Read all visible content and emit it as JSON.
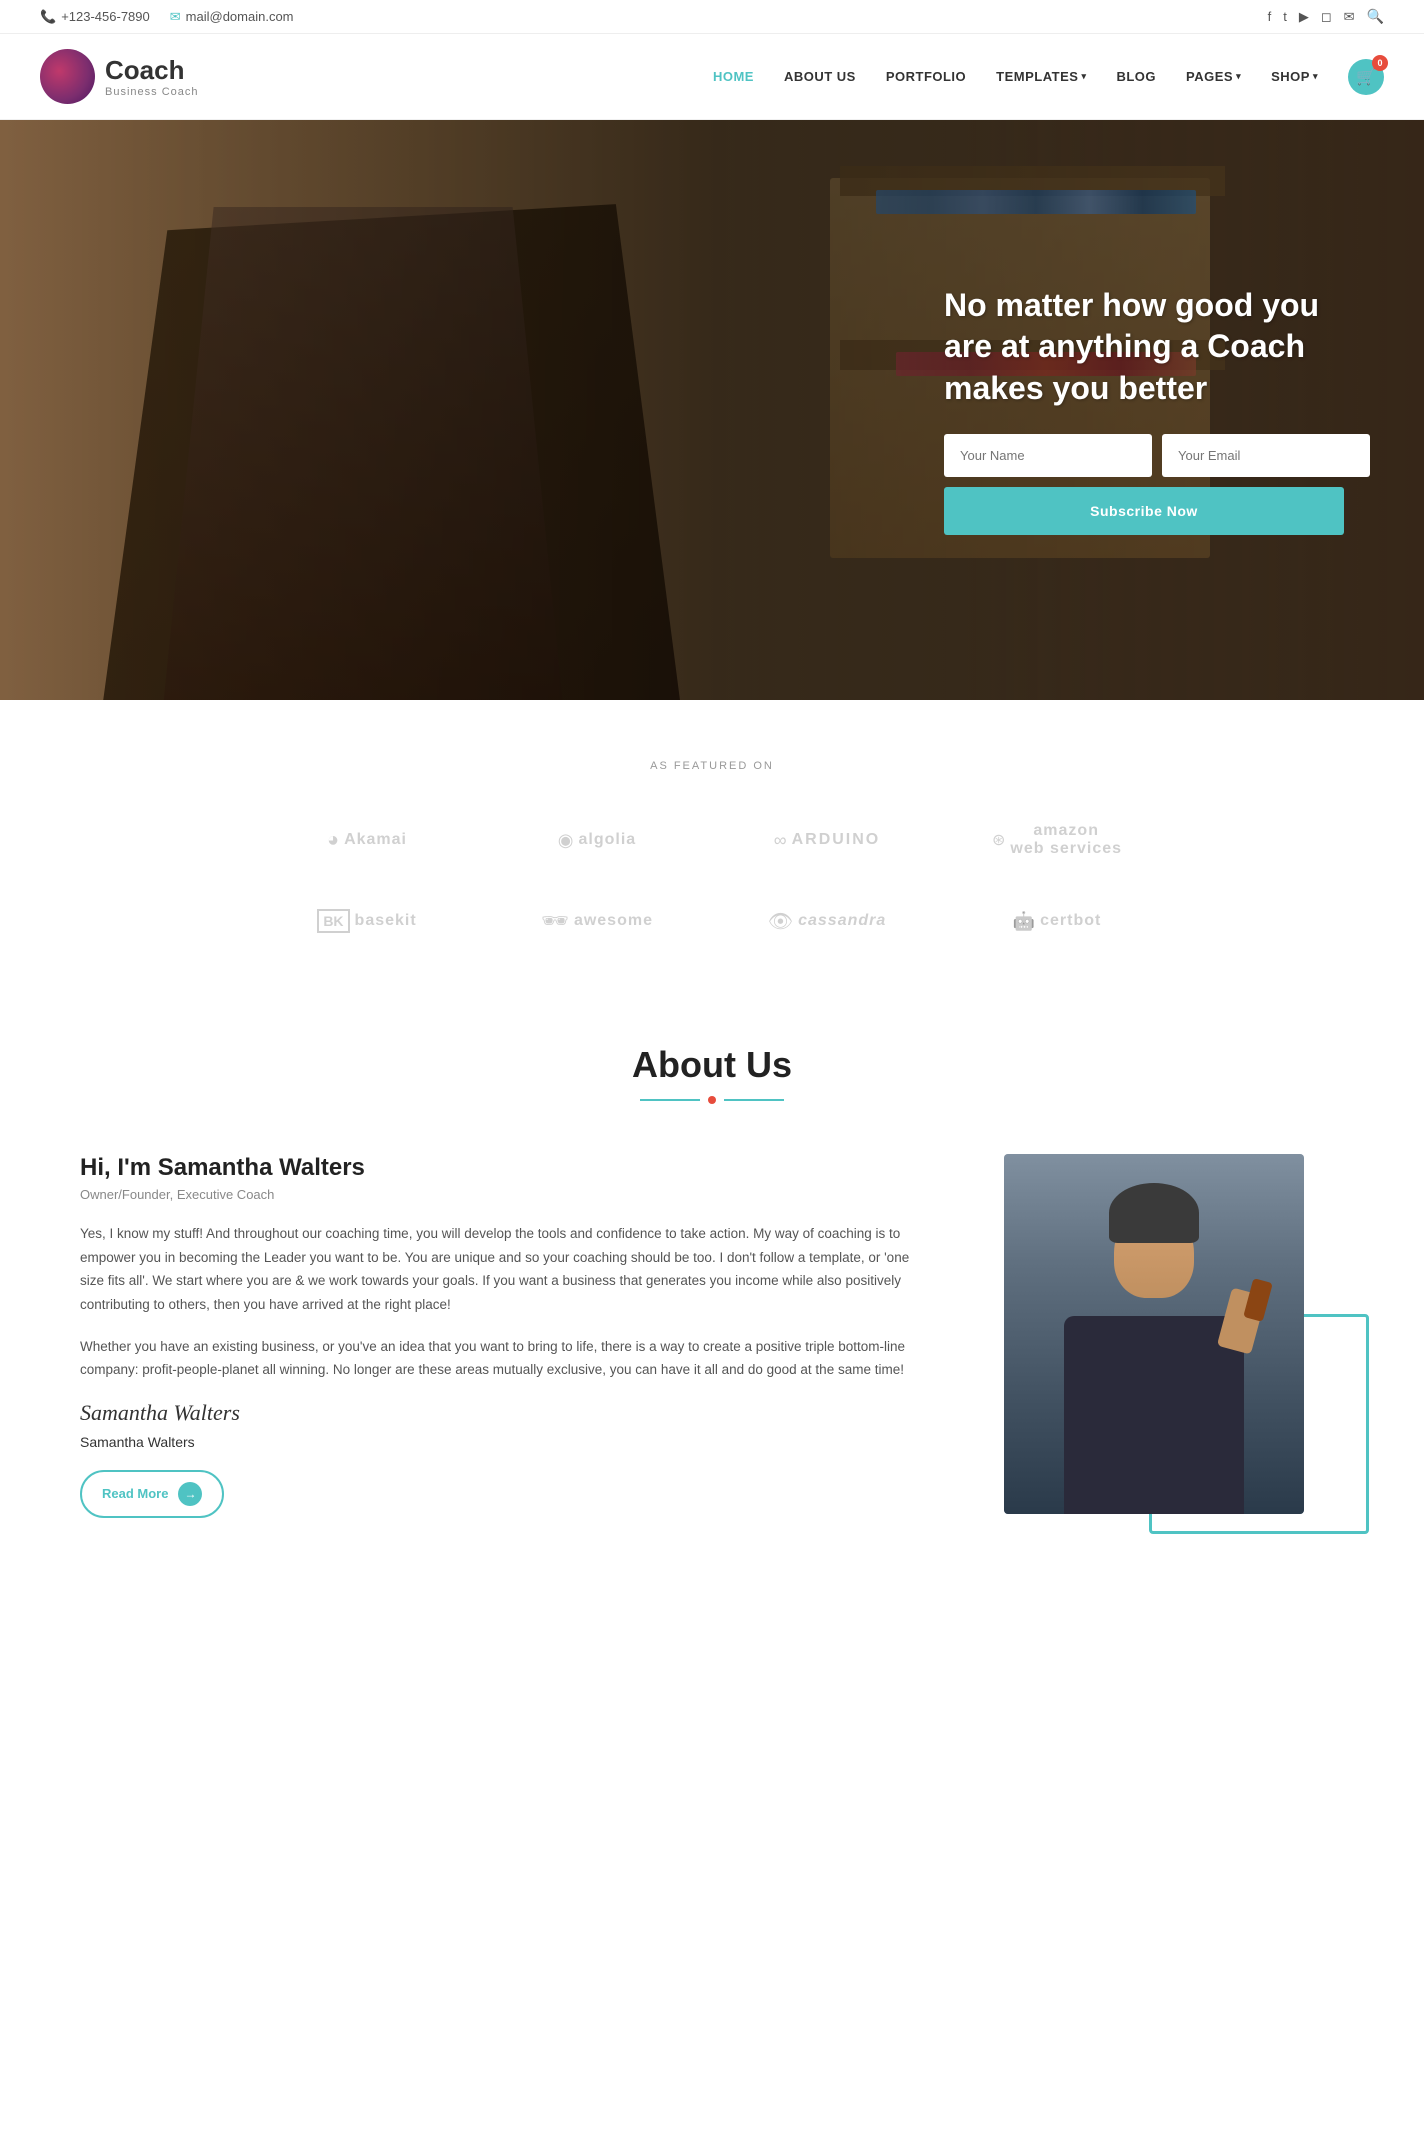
{
  "topbar": {
    "phone": "+123-456-7890",
    "email": "mail@domain.com",
    "socials": [
      "f",
      "t",
      "yt",
      "in",
      "m"
    ]
  },
  "header": {
    "logo_name": "Coach",
    "logo_tagline": "Business Coach",
    "nav": [
      {
        "label": "HOME",
        "active": true,
        "has_dropdown": false
      },
      {
        "label": "ABOUT US",
        "active": false,
        "has_dropdown": false
      },
      {
        "label": "PORTFOLIO",
        "active": false,
        "has_dropdown": false
      },
      {
        "label": "TEMPLATES",
        "active": false,
        "has_dropdown": true
      },
      {
        "label": "BLOG",
        "active": false,
        "has_dropdown": false
      },
      {
        "label": "PAGES",
        "active": false,
        "has_dropdown": true
      },
      {
        "label": "SHOP",
        "active": false,
        "has_dropdown": true
      }
    ],
    "cart_count": "0"
  },
  "hero": {
    "title": "No matter how good you are at anything a Coach makes you better",
    "name_placeholder": "Your Name",
    "email_placeholder": "Your Email",
    "subscribe_btn": "Subscribe Now"
  },
  "featured": {
    "label": "AS FEATURED ON",
    "brands": [
      {
        "name": "Akamai",
        "icon": "◕"
      },
      {
        "name": "algolia",
        "icon": "◉"
      },
      {
        "name": "ARDUINO",
        "icon": "∞"
      },
      {
        "name": "amazon web services",
        "icon": "⊙"
      },
      {
        "name": "basekit",
        "icon": "BK"
      },
      {
        "name": "awesome",
        "icon": "👓"
      },
      {
        "name": "cassandra",
        "icon": "👁"
      },
      {
        "name": "certbot",
        "icon": "🤖"
      }
    ]
  },
  "about": {
    "section_title": "About Us",
    "person_name": "Hi, I'm Samantha Walters",
    "person_role": "Owner/Founder, Executive Coach",
    "para1": "Yes, I know my stuff! And throughout our coaching time, you will develop the tools and confidence to take action. My way of coaching is to empower you in becoming the Leader you want to be. You are unique and so your coaching should be too. I don't follow a template, or 'one size fits all'. We start where you are & we work towards your goals. If you want a business that generates you income while also positively contributing to others, then you have arrived at the right place!",
    "para2": "Whether you have an existing business, or you've an idea that you want to bring to life, there is a way to create a positive triple bottom-line company: profit-people-planet all winning. No longer are these areas mutually exclusive, you can have it all and do good at the same time!",
    "signature": "Samantha Walters",
    "signature_name": "Samantha Walters",
    "read_more": "Read More"
  }
}
